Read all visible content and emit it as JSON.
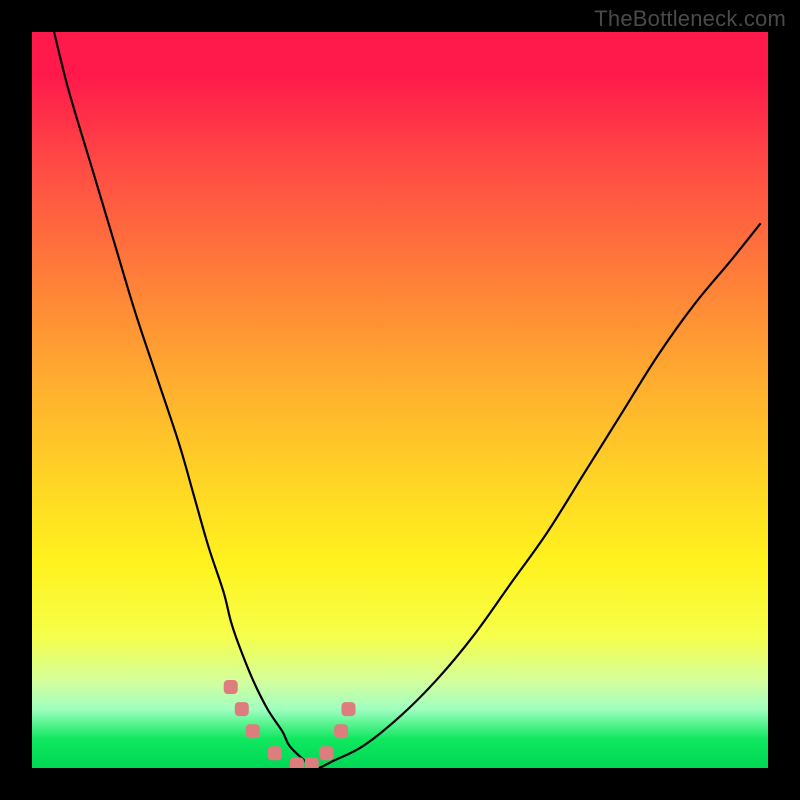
{
  "watermark": "TheBottleneck.com",
  "chart_data": {
    "type": "line",
    "title": "",
    "xlabel": "",
    "ylabel": "",
    "xlim": [
      0,
      100
    ],
    "ylim": [
      0,
      100
    ],
    "series": [
      {
        "name": "bottleneck-curve",
        "x": [
          3,
          5,
          8,
          11,
          14,
          17,
          20,
          22,
          24,
          26,
          27,
          28,
          30,
          32,
          34,
          35,
          37,
          38,
          39,
          41,
          45,
          50,
          55,
          60,
          65,
          70,
          75,
          80,
          85,
          90,
          95,
          99
        ],
        "values": [
          100,
          92,
          82,
          72,
          62,
          53,
          44,
          37,
          30,
          24,
          20,
          17,
          12,
          8,
          5,
          3,
          1,
          0,
          0,
          1,
          3,
          7,
          12,
          18,
          25,
          32,
          40,
          48,
          56,
          63,
          69,
          74
        ]
      },
      {
        "name": "curve-markers",
        "x": [
          27,
          28.5,
          30,
          33,
          36,
          38,
          40,
          42,
          43
        ],
        "values": [
          11,
          8,
          5,
          2,
          0.5,
          0.5,
          2,
          5,
          8
        ]
      }
    ],
    "gradient_stops": [
      {
        "pos": 0,
        "color": "#ff1a4b"
      },
      {
        "pos": 18,
        "color": "#ff4a45"
      },
      {
        "pos": 32,
        "color": "#ff7a3a"
      },
      {
        "pos": 46,
        "color": "#ffa830"
      },
      {
        "pos": 60,
        "color": "#ffd226"
      },
      {
        "pos": 72,
        "color": "#fff21e"
      },
      {
        "pos": 88,
        "color": "#d6ff9a"
      },
      {
        "pos": 96,
        "color": "#10e860"
      },
      {
        "pos": 100,
        "color": "#00d856"
      }
    ],
    "marker_color": "#dd7d7d",
    "curve_color": "#000000"
  }
}
